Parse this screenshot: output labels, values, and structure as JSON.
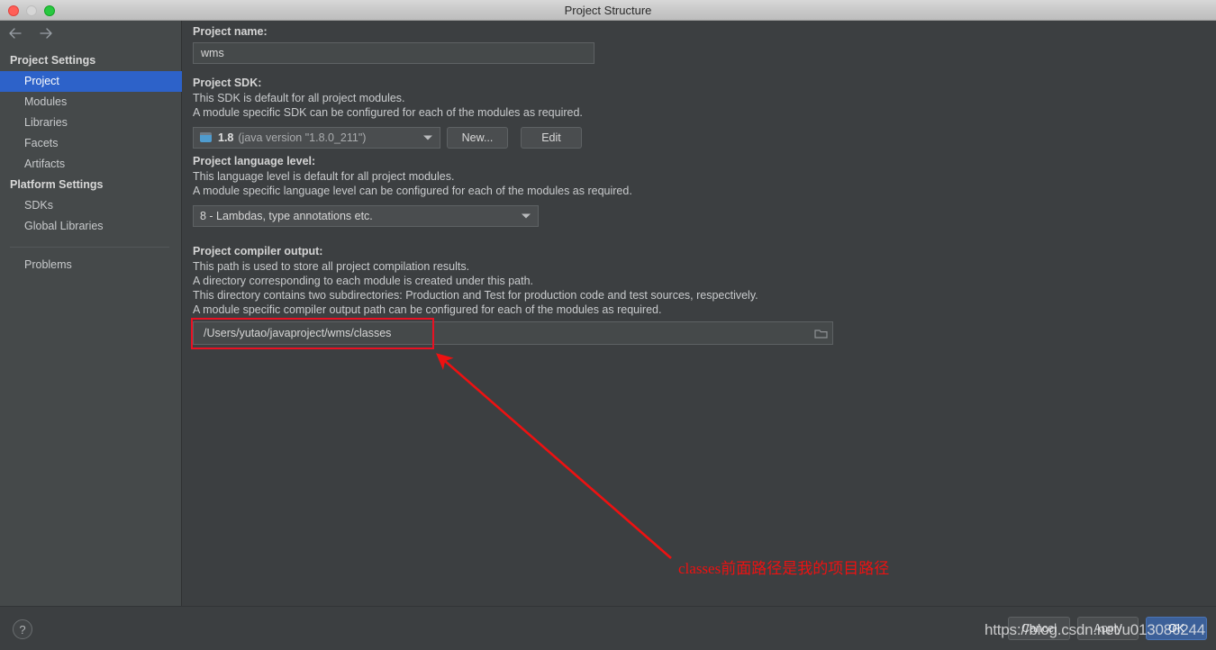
{
  "window": {
    "title": "Project Structure",
    "traffic_lights": [
      "close-red",
      "minimize-gray",
      "zoom-green"
    ]
  },
  "sidebar": {
    "back_icon": "arrow-left-icon",
    "forward_icon": "arrow-right-icon",
    "groups": [
      {
        "header": "Project Settings",
        "items": [
          {
            "label": "Project",
            "selected": true
          },
          {
            "label": "Modules",
            "selected": false
          },
          {
            "label": "Libraries",
            "selected": false
          },
          {
            "label": "Facets",
            "selected": false
          },
          {
            "label": "Artifacts",
            "selected": false
          }
        ]
      },
      {
        "header": "Platform Settings",
        "items": [
          {
            "label": "SDKs",
            "selected": false
          },
          {
            "label": "Global Libraries",
            "selected": false
          }
        ]
      }
    ],
    "problems": {
      "label": "Problems"
    }
  },
  "main": {
    "project_name": {
      "label": "Project name:",
      "value": "wms"
    },
    "project_sdk": {
      "label": "Project SDK:",
      "desc_lines": [
        "This SDK is default for all project modules.",
        "A module specific SDK can be configured for each of the modules as required."
      ],
      "icon": "sdk-icon",
      "version": "1.8",
      "detail": "(java version \"1.8.0_211\")",
      "new_button": "New...",
      "edit_button": "Edit"
    },
    "language_level": {
      "label": "Project language level:",
      "desc_lines": [
        "This language level is default for all project modules.",
        "A module specific language level can be configured for each of the modules as required."
      ],
      "value": "8 - Lambdas, type annotations etc."
    },
    "compiler_output": {
      "label": "Project compiler output:",
      "desc_lines": [
        "This path is used to store all project compilation results.",
        "A directory corresponding to each module is created under this path.",
        "This directory contains two subdirectories: Production and Test for production code and test sources, respectively.",
        "A module specific compiler output path can be configured for each of the modules as required."
      ],
      "value": "/Users/yutao/javaproject/wms/classes",
      "browse_icon": "folder-icon"
    }
  },
  "annotation": {
    "text": "classes前面路径是我的项目路径",
    "color": "#ee1111",
    "highlight_color": "#e81123"
  },
  "footer": {
    "help_label": "?",
    "cancel_label": "Cancel",
    "apply_label": "Apply",
    "ok_label": "OK"
  },
  "watermark": {
    "text": "https://blog.csdn.net/u013086244"
  }
}
